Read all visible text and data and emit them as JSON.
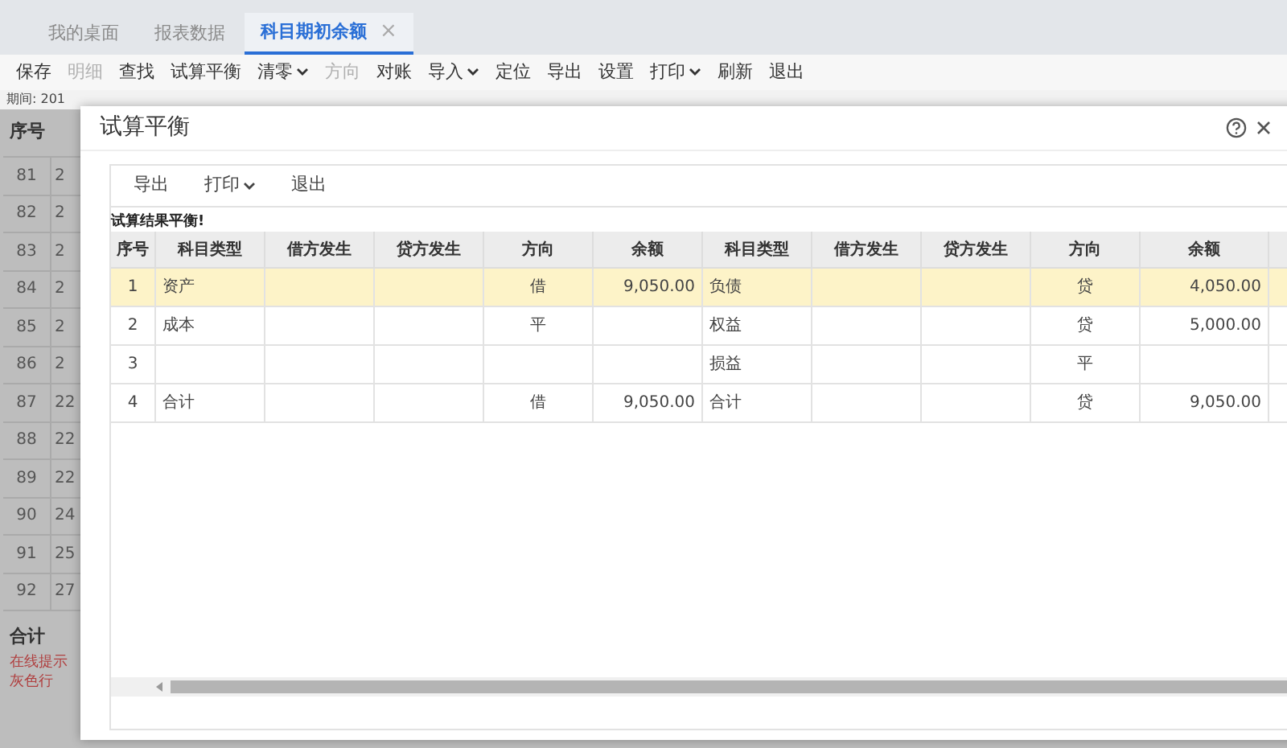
{
  "tabs": [
    {
      "label": "我的桌面",
      "selected": false,
      "closable": false
    },
    {
      "label": "报表数据",
      "selected": false,
      "closable": false
    },
    {
      "label": "科目期初余额",
      "selected": true,
      "closable": true
    }
  ],
  "close_glyph": "×",
  "toolbar": [
    {
      "label": "保存",
      "disabled": false,
      "dropdown": false
    },
    {
      "label": "明细",
      "disabled": true,
      "dropdown": false
    },
    {
      "label": "查找",
      "disabled": false,
      "dropdown": false
    },
    {
      "label": "试算平衡",
      "disabled": false,
      "dropdown": false
    },
    {
      "label": "清零",
      "disabled": false,
      "dropdown": true
    },
    {
      "label": "方向",
      "disabled": true,
      "dropdown": false
    },
    {
      "label": "对账",
      "disabled": false,
      "dropdown": false
    },
    {
      "label": "导入",
      "disabled": false,
      "dropdown": true
    },
    {
      "label": "定位",
      "disabled": false,
      "dropdown": false
    },
    {
      "label": "导出",
      "disabled": false,
      "dropdown": false
    },
    {
      "label": "设置",
      "disabled": false,
      "dropdown": false
    },
    {
      "label": "打印",
      "disabled": false,
      "dropdown": true
    },
    {
      "label": "刷新",
      "disabled": false,
      "dropdown": false
    },
    {
      "label": "退出",
      "disabled": false,
      "dropdown": false
    }
  ],
  "period_label": "期间: 201",
  "background_grid": {
    "header": "序号",
    "rows": [
      [
        "81",
        "2"
      ],
      [
        "82",
        "2"
      ],
      [
        "83",
        "2"
      ],
      [
        "84",
        "2"
      ],
      [
        "85",
        "2"
      ],
      [
        "86",
        "2"
      ],
      [
        "87",
        "22"
      ],
      [
        "88",
        "22"
      ],
      [
        "89",
        "22"
      ],
      [
        "90",
        "24"
      ],
      [
        "91",
        "25"
      ],
      [
        "92",
        "27"
      ]
    ],
    "total_label": "合计",
    "notes": [
      "在线提示",
      "灰色行"
    ]
  },
  "dialog": {
    "title": "试算平衡",
    "toolbar": [
      {
        "label": "导出",
        "dropdown": false
      },
      {
        "label": "打印",
        "dropdown": true
      },
      {
        "label": "退出",
        "dropdown": false
      }
    ],
    "result_message": "试算结果平衡!",
    "table": {
      "columns": [
        "序号",
        "科目类型",
        "借方发生",
        "贷方发生",
        "方向",
        "余额",
        "科目类型",
        "借方发生",
        "贷方发生",
        "方向",
        "余额"
      ],
      "rows": [
        {
          "selected": true,
          "cells": [
            "1",
            "资产",
            "",
            "",
            "借",
            "9,050.00",
            "负债",
            "",
            "",
            "贷",
            "4,050.00"
          ]
        },
        {
          "selected": false,
          "cells": [
            "2",
            "成本",
            "",
            "",
            "平",
            "",
            "权益",
            "",
            "",
            "贷",
            "5,000.00"
          ]
        },
        {
          "selected": false,
          "cells": [
            "3",
            "",
            "",
            "",
            "",
            "",
            "损益",
            "",
            "",
            "平",
            ""
          ]
        },
        {
          "selected": false,
          "cells": [
            "4",
            "合计",
            "",
            "",
            "借",
            "9,050.00",
            "合计",
            "",
            "",
            "贷",
            "9,050.00"
          ]
        }
      ]
    }
  }
}
